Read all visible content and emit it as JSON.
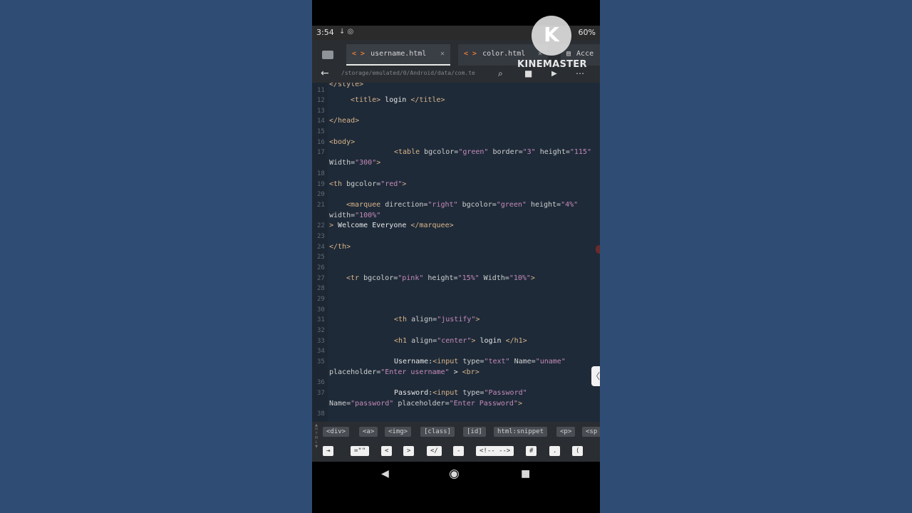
{
  "status": {
    "time": "3:54",
    "battery": "60%"
  },
  "watermark": "KINEMASTER",
  "tabs": [
    {
      "label": "username.html",
      "active": true
    },
    {
      "label": "color.html",
      "active": false
    },
    {
      "label": "Acce",
      "active": false
    }
  ],
  "toolbar": {
    "path": "/storage/emulated/0/Android/data/com.te"
  },
  "code_lines": [
    {
      "n": "",
      "indent": 0,
      "parts": [
        [
          "tag",
          "</style>"
        ]
      ]
    },
    {
      "n": "11",
      "indent": 0,
      "parts": []
    },
    {
      "n": "12",
      "indent": 30,
      "parts": [
        [
          "tag",
          "<title>"
        ],
        [
          "txt",
          " login "
        ],
        [
          "tag",
          "</title>"
        ]
      ]
    },
    {
      "n": "13",
      "indent": 0,
      "parts": []
    },
    {
      "n": "14",
      "indent": 0,
      "parts": [
        [
          "tag",
          "</head>"
        ]
      ]
    },
    {
      "n": "15",
      "indent": 0,
      "parts": []
    },
    {
      "n": "16",
      "indent": 0,
      "parts": [
        [
          "tag",
          "<body>"
        ]
      ]
    },
    {
      "n": "17",
      "indent": 91,
      "parts": [
        [
          "tag",
          "<table"
        ],
        [
          "attr",
          " bgcolor="
        ],
        [
          "str",
          "\"green\""
        ],
        [
          "attr",
          " border="
        ],
        [
          "str",
          "\"3\""
        ],
        [
          "attr",
          " height="
        ],
        [
          "str",
          "\"115\""
        ]
      ]
    },
    {
      "n": "",
      "indent": 0,
      "parts": [
        [
          "attr",
          "Width="
        ],
        [
          "str",
          "\"300\""
        ],
        [
          "tag",
          ">"
        ]
      ]
    },
    {
      "n": "18",
      "indent": 0,
      "parts": []
    },
    {
      "n": "19",
      "indent": 0,
      "parts": [
        [
          "tag",
          "<th"
        ],
        [
          "attr",
          " bgcolor="
        ],
        [
          "str",
          "\"red\""
        ],
        [
          "tag",
          ">"
        ]
      ]
    },
    {
      "n": "20",
      "indent": 0,
      "parts": []
    },
    {
      "n": "21",
      "indent": 24,
      "parts": [
        [
          "tag",
          "<marquee"
        ],
        [
          "attr",
          " direction="
        ],
        [
          "str",
          "\"right\""
        ],
        [
          "attr",
          " bgcolor="
        ],
        [
          "str",
          "\"green\""
        ],
        [
          "attr",
          " height="
        ],
        [
          "str",
          "\"4%\""
        ]
      ]
    },
    {
      "n": "",
      "indent": 0,
      "parts": [
        [
          "attr",
          "width="
        ],
        [
          "str",
          "\"100%\""
        ]
      ]
    },
    {
      "n": "22",
      "indent": 0,
      "parts": [
        [
          "tag",
          ">"
        ],
        [
          "txt",
          " Welcome Everyone "
        ],
        [
          "tag",
          "</marquee>"
        ]
      ]
    },
    {
      "n": "23",
      "indent": 0,
      "parts": []
    },
    {
      "n": "24",
      "indent": 0,
      "parts": [
        [
          "tag",
          "</th>"
        ]
      ]
    },
    {
      "n": "25",
      "indent": 0,
      "parts": []
    },
    {
      "n": "26",
      "indent": 0,
      "parts": []
    },
    {
      "n": "27",
      "indent": 24,
      "parts": [
        [
          "tag",
          "<tr"
        ],
        [
          "attr",
          " bgcolor="
        ],
        [
          "str",
          "\"pink\""
        ],
        [
          "attr",
          " height="
        ],
        [
          "str",
          "\"15%\""
        ],
        [
          "attr",
          " Width="
        ],
        [
          "str",
          "\"10%\""
        ],
        [
          "tag",
          ">"
        ]
      ]
    },
    {
      "n": "28",
      "indent": 0,
      "parts": []
    },
    {
      "n": "29",
      "indent": 0,
      "parts": []
    },
    {
      "n": "30",
      "indent": 0,
      "parts": []
    },
    {
      "n": "31",
      "indent": 91,
      "parts": [
        [
          "tag",
          "<th"
        ],
        [
          "attr",
          " align="
        ],
        [
          "str",
          "\"justify\""
        ],
        [
          "tag",
          ">"
        ]
      ]
    },
    {
      "n": "32",
      "indent": 0,
      "parts": []
    },
    {
      "n": "33",
      "indent": 91,
      "parts": [
        [
          "tag",
          "<h1"
        ],
        [
          "attr",
          " align="
        ],
        [
          "str",
          "\"center\""
        ],
        [
          "tag",
          ">"
        ],
        [
          "txt",
          " login "
        ],
        [
          "tag",
          "</h1>"
        ]
      ]
    },
    {
      "n": "34",
      "indent": 0,
      "parts": []
    },
    {
      "n": "35",
      "indent": 91,
      "parts": [
        [
          "txt",
          "Username:"
        ],
        [
          "tag",
          "<input"
        ],
        [
          "attr",
          " type="
        ],
        [
          "str",
          "\"text\""
        ],
        [
          "attr",
          " Name="
        ],
        [
          "str",
          "\"uname\""
        ]
      ]
    },
    {
      "n": "",
      "indent": 0,
      "parts": [
        [
          "attr",
          "placeholder="
        ],
        [
          "str",
          "\"Enter username\""
        ],
        [
          "txt",
          " > "
        ],
        [
          "tag",
          "<br>"
        ]
      ]
    },
    {
      "n": "36",
      "indent": 0,
      "parts": []
    },
    {
      "n": "37",
      "indent": 91,
      "parts": [
        [
          "txt",
          "Password:"
        ],
        [
          "tag",
          "<input"
        ],
        [
          "attr",
          " type="
        ],
        [
          "str",
          "\"Password\""
        ]
      ]
    },
    {
      "n": "",
      "indent": 0,
      "parts": [
        [
          "attr",
          "Name="
        ],
        [
          "str",
          "\"password\""
        ],
        [
          "attr",
          " placeholder="
        ],
        [
          "str",
          "\"Enter Password\""
        ],
        [
          "tag",
          ">"
        ]
      ]
    },
    {
      "n": "38",
      "indent": 0,
      "parts": []
    }
  ],
  "snippets_row1": [
    "<div>",
    "<a>",
    "<img>",
    "[class]",
    "[id]",
    "html:snippet",
    "<p>",
    "<sp"
  ],
  "snippets_row2": [
    "⇥",
    "=\"\"",
    "<",
    ">",
    "</",
    "-",
    "<!-- -->",
    "#",
    ".",
    "("
  ],
  "colors": {
    "tag": "#d9b48a",
    "string": "#c58ab8",
    "editor_bg": "#1e2a38",
    "tab_icon": "#e07a3a"
  }
}
